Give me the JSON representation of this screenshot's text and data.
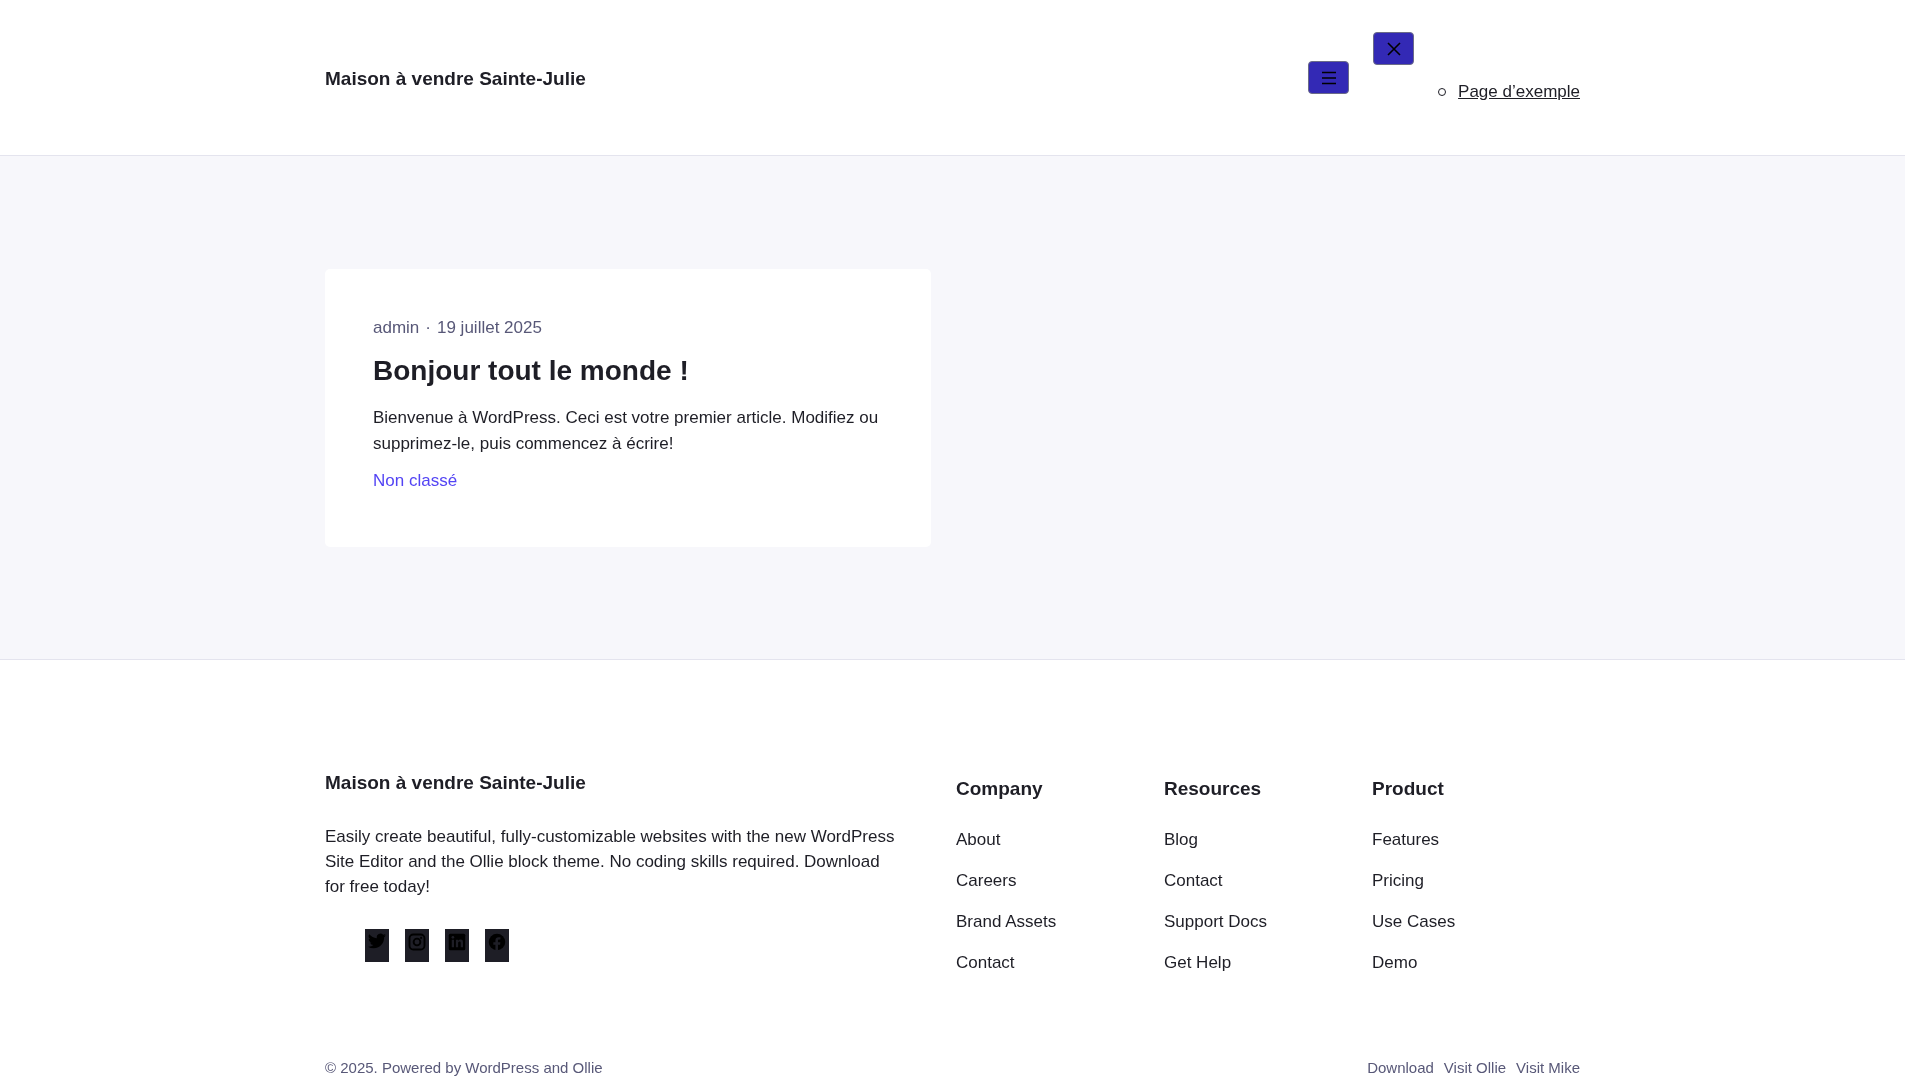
{
  "header": {
    "site_title": "Maison à vendre Sainte-Julie",
    "nav_items": [
      "Page d’exemple"
    ]
  },
  "post": {
    "author": "admin",
    "separator": "·",
    "date": "19 juillet 2025",
    "title": "Bonjour tout le monde !",
    "excerpt": "Bienvenue à WordPress. Ceci est votre premier article. Modifiez ou supprimez-le, puis commencez à écrire!",
    "category": "Non classé"
  },
  "footer": {
    "site_title": "Maison à vendre Sainte-Julie",
    "description": "Easily create beautiful, fully-customizable websites with the new WordPress Site Editor and the Ollie block theme. No coding skills required. Download for free today!",
    "social": [
      {
        "kind": "twitter"
      },
      {
        "kind": "instagram"
      },
      {
        "kind": "linkedin"
      },
      {
        "kind": "facebook"
      }
    ],
    "columns": [
      {
        "heading": "Company",
        "links": [
          "About",
          "Careers",
          "Brand Assets",
          "Contact"
        ]
      },
      {
        "heading": "Resources",
        "links": [
          "Blog",
          "Contact",
          "Support Docs",
          "Get Help"
        ]
      },
      {
        "heading": "Product",
        "links": [
          "Features",
          "Pricing",
          "Use Cases",
          "Demo"
        ]
      }
    ],
    "copyright": "© 2025. Powered by WordPress and Ollie",
    "bottom_links": [
      "Download",
      "Visit Ollie",
      "Visit Mike"
    ]
  }
}
